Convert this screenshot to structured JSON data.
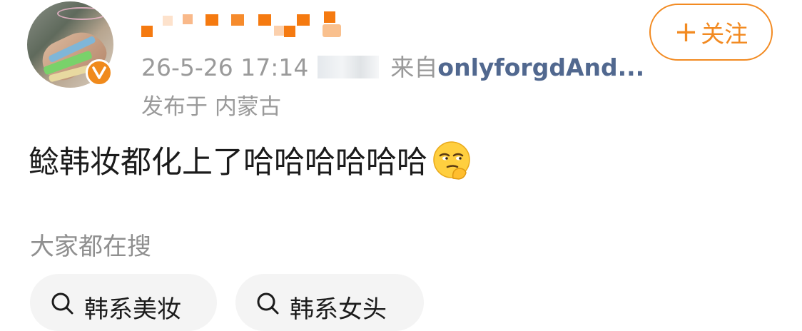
{
  "post": {
    "author": {
      "avatar_icon": "avatar",
      "verified_badge": "v"
    },
    "date": "26-5-26",
    "time": "17:14",
    "from_label": "来自",
    "source": "onlyforgdAnd...",
    "location": "发布于 内蒙古",
    "text": "鲶韩妆都化上了哈哈哈哈哈哈",
    "emoji": "thinking-smirk-emoji",
    "follow_label": "关注",
    "follow_plus": "+"
  },
  "search": {
    "title": "大家都在搜",
    "chips": [
      {
        "label": "韩系美妆"
      },
      {
        "label": "韩系女头"
      }
    ]
  },
  "colors": {
    "accent": "#f28a21",
    "link": "#51688f",
    "muted": "#9a9a9a"
  }
}
